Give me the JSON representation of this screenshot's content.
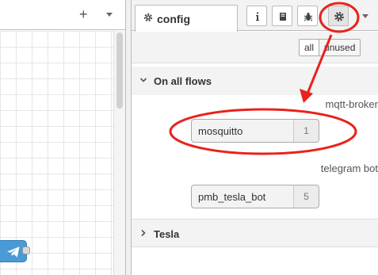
{
  "workspace": {
    "add_icon": "plus-icon",
    "menu_icon": "caret-down-icon",
    "node_icon": "telegram-icon",
    "node_color": "#4a9ad6"
  },
  "sidebar": {
    "active_tab": {
      "label": "config",
      "icon": "gear-icon"
    },
    "buttons": [
      {
        "name": "info",
        "icon": "info-icon"
      },
      {
        "name": "help",
        "icon": "book-icon"
      },
      {
        "name": "debug",
        "icon": "bug-icon"
      },
      {
        "name": "config",
        "icon": "gear-icon",
        "active": true
      }
    ],
    "filters": [
      {
        "label": "all",
        "selected": true
      },
      {
        "label": "unused",
        "selected": false
      }
    ],
    "sections": [
      {
        "title": "On all flows",
        "expanded": true,
        "groups": [
          {
            "type": "mqtt-broker",
            "nodes": [
              {
                "name": "mosquitto",
                "count": "1"
              }
            ]
          },
          {
            "type": "telegram bot",
            "nodes": [
              {
                "name": "pmb_tesla_bot",
                "count": "5"
              }
            ]
          }
        ]
      },
      {
        "title": "Tesla",
        "expanded": false
      }
    ]
  },
  "annotation": {
    "color": "#e8231c"
  }
}
